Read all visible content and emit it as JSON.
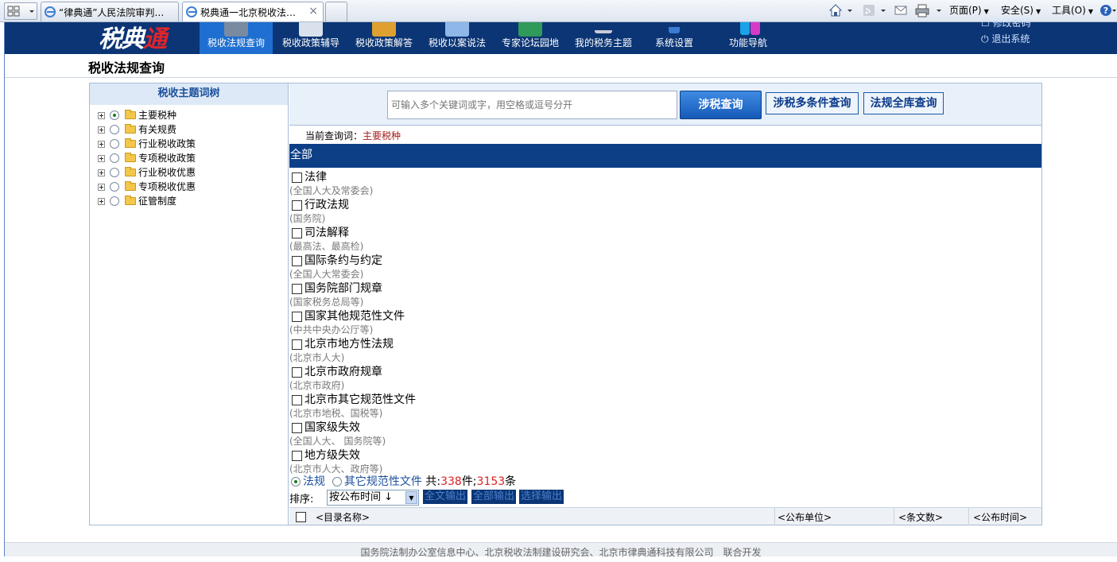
{
  "browser": {
    "tabs": [
      {
        "label": "“律典通”人民法院审判…"
      },
      {
        "label": "税典通一北京税收法…",
        "close": "×"
      }
    ],
    "commands": {
      "page": "页面(P)",
      "safety": "安全(S)",
      "tools": "工具(O)"
    }
  },
  "header": {
    "logo_a": "税典",
    "logo_b": "通",
    "nav": [
      {
        "label": "税收法规查询",
        "active": true,
        "icon_color": "#7a8aa0"
      },
      {
        "label": "税收政策辅导",
        "icon_color": "#d9e2ec"
      },
      {
        "label": "税收政策解答",
        "icon_color": "#e0a030"
      },
      {
        "label": "税收以案说法",
        "icon_color": "#8fb8e8"
      },
      {
        "label": "专家论坛园地",
        "icon_color": "#2f9a5a"
      },
      {
        "label": "我的税务主题",
        "icon_color": "#c8ccd4"
      },
      {
        "label": "系统设置",
        "icon_color": "#3a7bd5"
      },
      {
        "label": "功能导航",
        "icon_color": "#d63bc8"
      }
    ],
    "user_links": [
      "修改密码",
      "退出系统"
    ]
  },
  "page_title": "税收法规查询",
  "tree": {
    "title": "税收主题词树",
    "nodes": [
      {
        "label": "主要税种",
        "selected": true
      },
      {
        "label": "有关规费"
      },
      {
        "label": "行业税收政策"
      },
      {
        "label": "专项税收政策"
      },
      {
        "label": "行业税收优惠"
      },
      {
        "label": "专项税收优惠"
      },
      {
        "label": "征管制度"
      }
    ]
  },
  "search": {
    "placeholder": "可输入多个关键词或字，用空格或逗号分开",
    "tax_search": "涉税查询",
    "multi_search": "涉税多条件查询",
    "full_search": "法规全库查询"
  },
  "current_query": {
    "label": "当前查询词：",
    "value": "主要税种"
  },
  "all_label": "全部",
  "categories": [
    {
      "name": "法律",
      "sub": "(全国人大及常委会)"
    },
    {
      "name": "行政法规",
      "sub": "(国务院)"
    },
    {
      "name": "司法解释",
      "sub": "(最高法、最高检)"
    },
    {
      "name": "国际条约与约定",
      "sub": "(全国人大常委会)"
    },
    {
      "name": "国务院部门规章",
      "sub": "(国家税务总局等)"
    },
    {
      "name": "国家其他规范性文件",
      "sub": "(中共中央办公厅等)"
    },
    {
      "name": "北京市地方性法规",
      "sub": "(北京市人大)"
    },
    {
      "name": "北京市政府规章",
      "sub": "(北京市政府)"
    },
    {
      "name": "北京市其它规范性文件",
      "sub": "(北京市地税、国税等)"
    },
    {
      "name": "国家级失效",
      "sub": "(全国人大、 国务院等)"
    },
    {
      "name": "地方级失效",
      "sub": "(北京市人大、政府等)"
    }
  ],
  "type_filter": {
    "law": "法规",
    "other": "其它规范性文件",
    "total_prefix": "共:",
    "doc_count": "338",
    "doc_unit": "件;",
    "article_count": "3153",
    "article_unit": "条"
  },
  "sort": {
    "label": "排序:",
    "selected": "按公布时间 ↓",
    "full_export": "全文输出",
    "all_export": "全部输出",
    "selected_export": "选择输出"
  },
  "columns": {
    "name": "<目录名称>",
    "issuer": "<公布单位>",
    "articles": "<条文数>",
    "date": "<公布时间>"
  },
  "footer": "国务院法制办公室信息中心、北京税收法制建设研究会、北京市律典通科技有限公司　联合开发",
  "colors": {
    "header_bg": "#0b3574",
    "nav_active": "#1e6fd1",
    "accent_red": "#d22222"
  }
}
